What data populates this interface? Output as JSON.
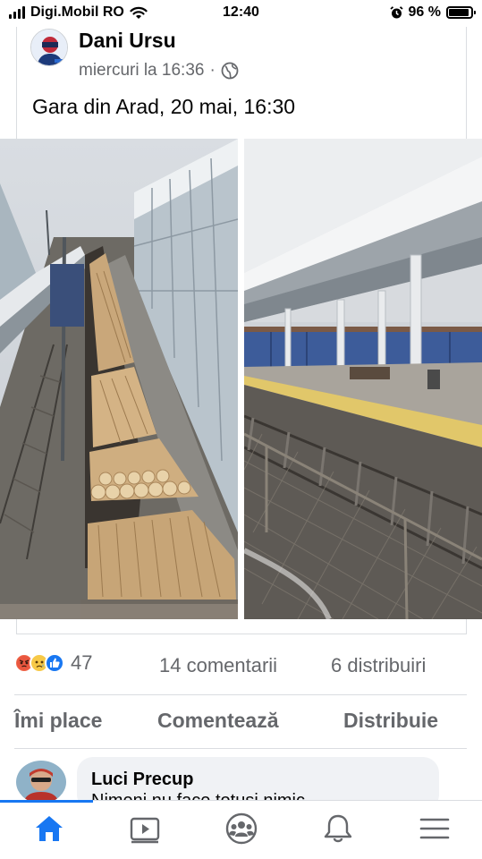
{
  "status_bar": {
    "carrier": "Digi.Mobil RO",
    "time": "12:40",
    "battery": "96 %",
    "battery_level": 0.96
  },
  "post": {
    "author": "Dani Ursu",
    "timestamp": "miercuri la 16:36",
    "separator": "·",
    "text": "Gara din Arad, 20 mai, 16:30"
  },
  "engagement": {
    "reaction_icons": [
      "angry-reaction-icon",
      "sad-reaction-icon",
      "like-reaction-icon"
    ],
    "reaction_count": "47",
    "comments": "14 comentarii",
    "shares": "6 distribuiri"
  },
  "actions": {
    "like": "Îmi place",
    "comment": "Comentează",
    "share": "Distribuie"
  },
  "comment": {
    "author": "Luci Precup",
    "text": "Nimeni nu face totusi nimic"
  },
  "tabbar": {
    "items": [
      "home-icon",
      "video-icon",
      "groups-icon",
      "notifications-icon",
      "menu-icon"
    ],
    "active": "home-icon",
    "accent": "#1877f2",
    "inactive": "#65676b"
  }
}
